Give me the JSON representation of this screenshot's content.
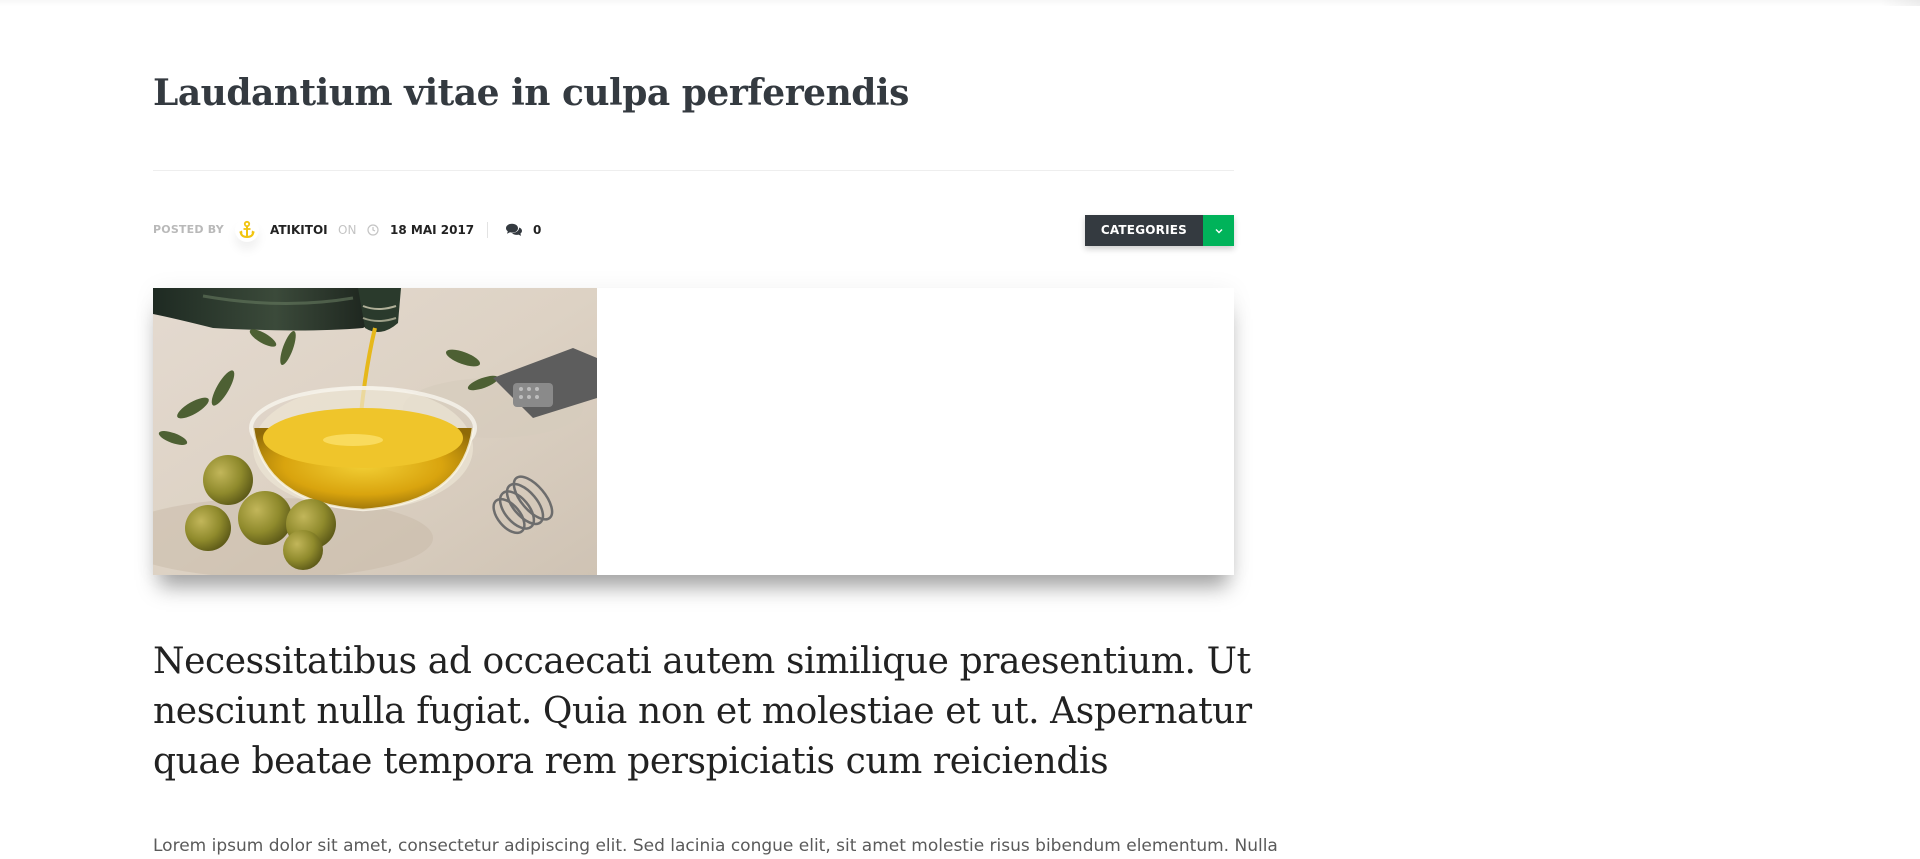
{
  "post": {
    "title": "Laudantium vitae in culpa perferendis",
    "meta": {
      "posted_by_label": "POSTED BY",
      "author": "ATIKITOI",
      "on_label": "ON",
      "date": "18 MAI 2017",
      "comment_count": "0"
    },
    "categories_label": "CATEGORIES",
    "lead": "Necessitatibus ad occaecati autem similique praesentium. Ut nesciunt nulla fugiat. Quia non et molestiae et ut. Aspernatur quae beatae tempora rem perspiciatis cum reiciendis",
    "body": "Lorem ipsum dolor sit amet, consectetur adipiscing elit. Sed lacinia congue elit, sit amet molestie risus bibendum elementum. Nulla"
  },
  "icons": {
    "avatar": "anchor-icon",
    "date": "clock-icon",
    "comments": "comments-icon",
    "categories_toggle": "chevron-down-icon"
  },
  "colors": {
    "title": "#343a40",
    "categories_bg": "#343a40",
    "categories_toggle_bg": "#00b35a",
    "avatar_icon": "#f1c40f"
  }
}
